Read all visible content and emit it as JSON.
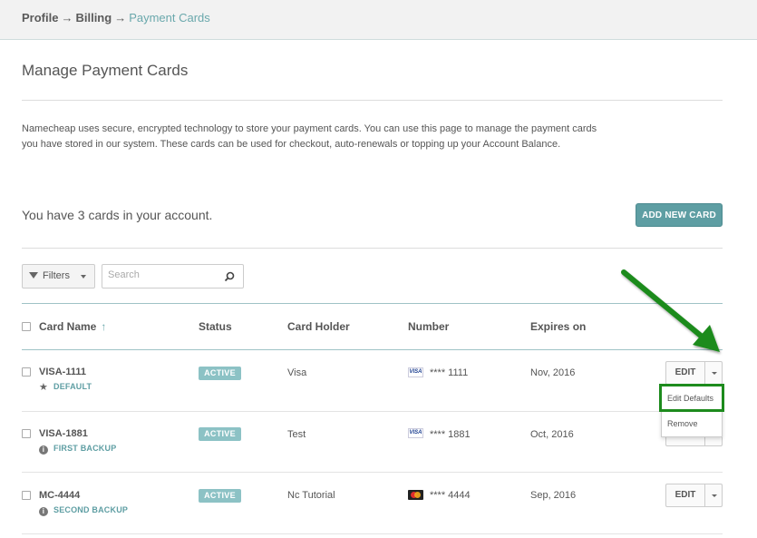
{
  "breadcrumb": {
    "profile": "Profile",
    "billing": "Billing",
    "current": "Payment Cards",
    "separator": "→"
  },
  "page": {
    "title": "Manage Payment Cards",
    "description": "Namecheap uses secure, encrypted technology to store your payment cards. You can use this page to manage the payment cards you have stored in our system. These cards can be used for checkout, auto-renewals or topping up your Account Balance.",
    "card_count_text": "You have 3 cards in your account.",
    "add_button": "ADD NEW CARD"
  },
  "toolbar": {
    "filters_label": "Filters",
    "search_placeholder": "Search"
  },
  "table": {
    "headers": {
      "card_name": "Card Name",
      "sort_arrow": "↑",
      "status": "Status",
      "card_holder": "Card Holder",
      "number": "Number",
      "expires": "Expires on"
    },
    "rows": [
      {
        "name": "VISA-1111",
        "sub": "DEFAULT",
        "sub_icon": "star-icon",
        "status": "ACTIVE",
        "holder": "Visa",
        "brand": "VISA",
        "number": "**** 1111",
        "expires": "Nov, 2016",
        "edit": "EDIT"
      },
      {
        "name": "VISA-1881",
        "sub": "FIRST BACKUP",
        "sub_icon": "info-icon",
        "status": "ACTIVE",
        "holder": "Test",
        "brand": "VISA",
        "number": "**** 1881",
        "expires": "Oct, 2016",
        "edit": "EDIT"
      },
      {
        "name": "MC-4444",
        "sub": "SECOND BACKUP",
        "sub_icon": "info-icon",
        "status": "ACTIVE",
        "holder": "Nc Tutorial",
        "brand": "mastercard",
        "number": "**** 4444",
        "expires": "Sep, 2016",
        "edit": "EDIT"
      }
    ]
  },
  "dropdown": {
    "items": [
      "Edit Defaults",
      "Remove"
    ]
  },
  "colors": {
    "accent": "#5e9ea3",
    "badge": "#8cc2c5",
    "highlight": "#1d8b1d"
  }
}
